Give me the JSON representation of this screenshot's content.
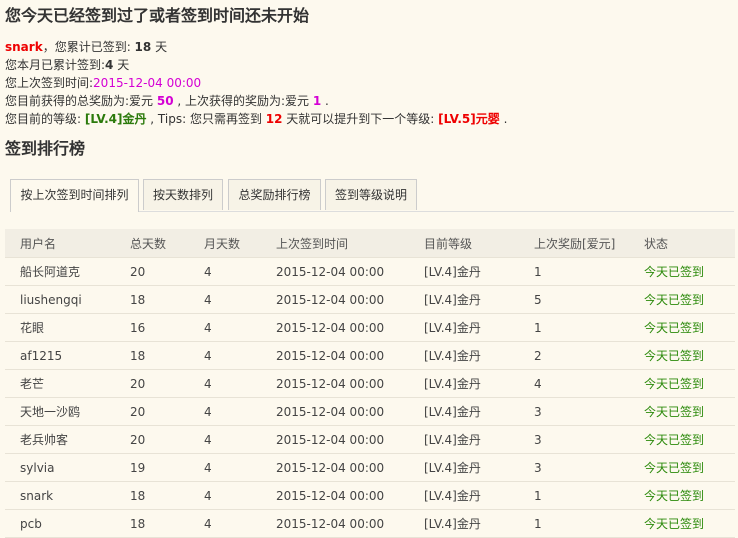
{
  "header": {
    "title": "您今天已经签到过了或者签到时间还未开始"
  },
  "summary": {
    "username": "snark",
    "total_prefix": "，您累计已签到: ",
    "total_days": "18",
    "total_suffix": " 天",
    "month_prefix": "您本月已累计签到:",
    "month_days": "4",
    "month_suffix": " 天",
    "last_prefix": "您上次签到时间:",
    "last_time": "2015-12-04 00:00",
    "reward_prefix": "您目前获得的总奖励为:爱元 ",
    "reward_total": "50",
    "reward_mid": " , 上次获得的奖励为:爱元 ",
    "reward_last": "1",
    "reward_suffix": " .",
    "level_prefix": "您目前的等级: ",
    "level_current": "[LV.4]金丹",
    "level_mid": " , Tips: 您只需再签到 ",
    "level_days": "12",
    "level_mid2": " 天就可以提升到下一个等级: ",
    "level_next": "[LV.5]元婴",
    "level_suffix": " ."
  },
  "ranking": {
    "title": "签到排行榜",
    "tabs": [
      "按上次签到时间排列",
      "按天数排列",
      "总奖励排行榜",
      "签到等级说明"
    ],
    "columns": [
      "用户名",
      "总天数",
      "月天数",
      "上次签到时间",
      "目前等级",
      "上次奖励[爱元]",
      "状态"
    ],
    "rows": [
      [
        "船长阿道克",
        "20",
        "4",
        "2015-12-04 00:00",
        "[LV.4]金丹",
        "1",
        "今天已签到"
      ],
      [
        "liushengqi",
        "18",
        "4",
        "2015-12-04 00:00",
        "[LV.4]金丹",
        "5",
        "今天已签到"
      ],
      [
        "花眼",
        "16",
        "4",
        "2015-12-04 00:00",
        "[LV.4]金丹",
        "1",
        "今天已签到"
      ],
      [
        "af1215",
        "18",
        "4",
        "2015-12-04 00:00",
        "[LV.4]金丹",
        "2",
        "今天已签到"
      ],
      [
        "老芒",
        "20",
        "4",
        "2015-12-04 00:00",
        "[LV.4]金丹",
        "4",
        "今天已签到"
      ],
      [
        "天地一沙鸥",
        "20",
        "4",
        "2015-12-04 00:00",
        "[LV.4]金丹",
        "3",
        "今天已签到"
      ],
      [
        "老兵帅客",
        "20",
        "4",
        "2015-12-04 00:00",
        "[LV.4]金丹",
        "3",
        "今天已签到"
      ],
      [
        "sylvia",
        "19",
        "4",
        "2015-12-04 00:00",
        "[LV.4]金丹",
        "3",
        "今天已签到"
      ],
      [
        "snark",
        "18",
        "4",
        "2015-12-04 00:00",
        "[LV.4]金丹",
        "1",
        "今天已签到"
      ],
      [
        "pcb",
        "18",
        "4",
        "2015-12-04 00:00",
        "[LV.4]金丹",
        "1",
        "今天已签到"
      ]
    ]
  },
  "colors": {
    "background": "#fdf9ee",
    "username_red": "#e00000",
    "time_magenta": "#d400d4",
    "level_green": "#2b7a0b",
    "status_green": "#2b8a0b"
  }
}
